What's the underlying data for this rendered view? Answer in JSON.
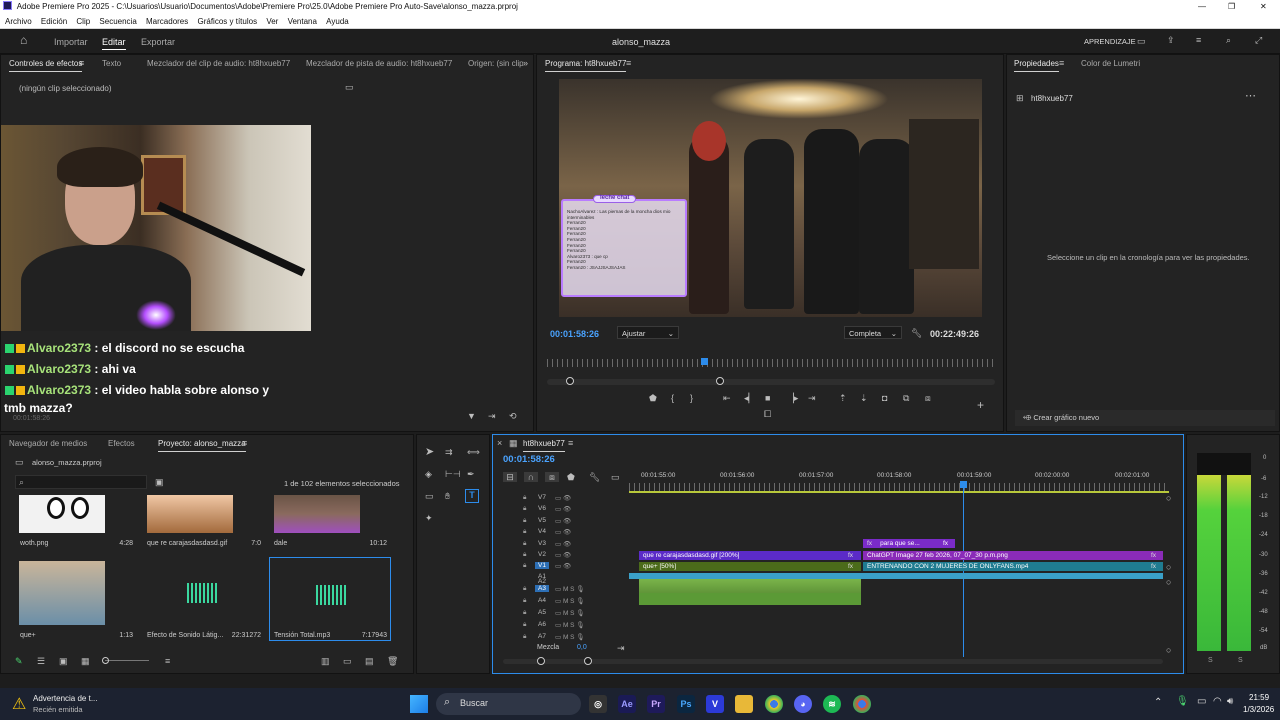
{
  "window": {
    "title": "Adobe Premiere Pro 2025 - C:\\Usuarios\\Usuario\\Documentos\\Adobe\\Premiere Pro\\25.0\\Adobe Premiere Pro Auto-Save\\alonso_mazza.prproj"
  },
  "menu": [
    "Archivo",
    "Edición",
    "Clip",
    "Secuencia",
    "Marcadores",
    "Gráficos y títulos",
    "Ver",
    "Ventana",
    "Ayuda"
  ],
  "appbar": {
    "tabs": [
      "Importar",
      "Editar",
      "Exportar"
    ],
    "project_name": "alonso_mazza",
    "learning": "APRENDIZAJE"
  },
  "source_panel": {
    "tabs": [
      "Controles de efectos",
      "Texto",
      "Mezclador del clip de audio: ht8hxueb77",
      "Mezclador de pista de audio: ht8hxueb77",
      "Origen: (sin clip"
    ],
    "no_clip": "(ningún clip seleccionado)",
    "timecode": "00:01:58:26"
  },
  "chat": [
    {
      "user": "Alvaro2373",
      "msg": ": el discord no se escucha"
    },
    {
      "user": "Alvaro2373",
      "msg": ": ahi va"
    },
    {
      "user": "Alvaro2373",
      "msg": ": el video habla sobre alonso y"
    },
    {
      "user": "",
      "msg": "tmb mazza?"
    }
  ],
  "program": {
    "tab": "Programa: ht8hxueb77",
    "timecode": "00:01:58:26",
    "fit": "Ajustar",
    "quality": "Completa",
    "duration": "00:22:49:26",
    "overlay_title": "leche chat",
    "overlay_lines": [
      "NachoAlvarez : Las piernas de la moncha dios mio",
      "interminables",
      "Ferran20",
      "Ferran20",
      "Ferran20",
      "Ferran20",
      "Ferran20",
      "Ferran20",
      "Alvaro2373 : que cp",
      "Ferran20",
      "Ferran20 : JSAJJSAJSAJAS"
    ]
  },
  "properties": {
    "tabs": [
      "Propiedades",
      "Color de Lumetri"
    ],
    "sequence": "ht8hxueb77",
    "hint": "Seleccione un clip en la cronología para ver las propiedades.",
    "new_graphic": "Crear gráfico nuevo"
  },
  "project": {
    "tabs": [
      "Navegador de medios",
      "Efectos",
      "Proyecto: alonso_mazza"
    ],
    "file": "alonso_mazza.prproj",
    "selection_count": "1 de 102 elementos seleccionados",
    "items": [
      {
        "name": "woth.png",
        "duration": "4:28"
      },
      {
        "name": "que re carajasdasdasd.gif",
        "duration": "7:0"
      },
      {
        "name": "dale",
        "duration": "10:12"
      },
      {
        "name": "que+",
        "duration": "1:13"
      },
      {
        "name": "Efecto de Sonido Látig...",
        "duration": "22:31272"
      },
      {
        "name": "Tensión Total.mp3",
        "duration": "7:17943"
      }
    ]
  },
  "timeline": {
    "tab": "ht8hxueb77",
    "timecode": "00:01:58:26",
    "ruler": [
      "00:01:55:00",
      "00:01:56:00",
      "00:01:57:00",
      "00:01:58:00",
      "00:01:59:00",
      "00:02:00:00",
      "00:02:01:00"
    ],
    "video_tracks": [
      "V7",
      "V6",
      "V5",
      "V4",
      "V3",
      "V2",
      "V1"
    ],
    "audio_tracks": [
      "A1",
      "A2",
      "A3",
      "A4",
      "A5",
      "A6",
      "A7"
    ],
    "mix_label": "Mezcla",
    "mix_value": "0,0",
    "clips": {
      "v3": "para que se...",
      "v2a": "que re carajasdasdasd.gif [200%]",
      "v2b": "ChatGPT Image 27 feb 2026, 07_07_30 p.m.png",
      "v1a": "que+ [50%]",
      "v1b": "ENTRENANDO CON 2 MUJERES DE ONLYFANS.mp4"
    },
    "fx": "fx"
  },
  "meter": {
    "labels": [
      "0",
      "-6",
      "-12",
      "-18",
      "-24",
      "-30",
      "-36",
      "-42",
      "-48",
      "-54",
      "dB"
    ],
    "channels": [
      "S",
      "S"
    ]
  },
  "taskbar": {
    "notif_title": "Advertencia de t...",
    "notif_sub": "Recién emitida",
    "search": "Buscar",
    "time": "21:59",
    "date": "1/3/2026"
  },
  "colors": {
    "accent": "#2d8ceb",
    "clip_purple": "#7a2bc8",
    "clip_green": "#4b6b1a",
    "clip_teal": "#1f7c91",
    "audio_green": "#6aa63a"
  }
}
